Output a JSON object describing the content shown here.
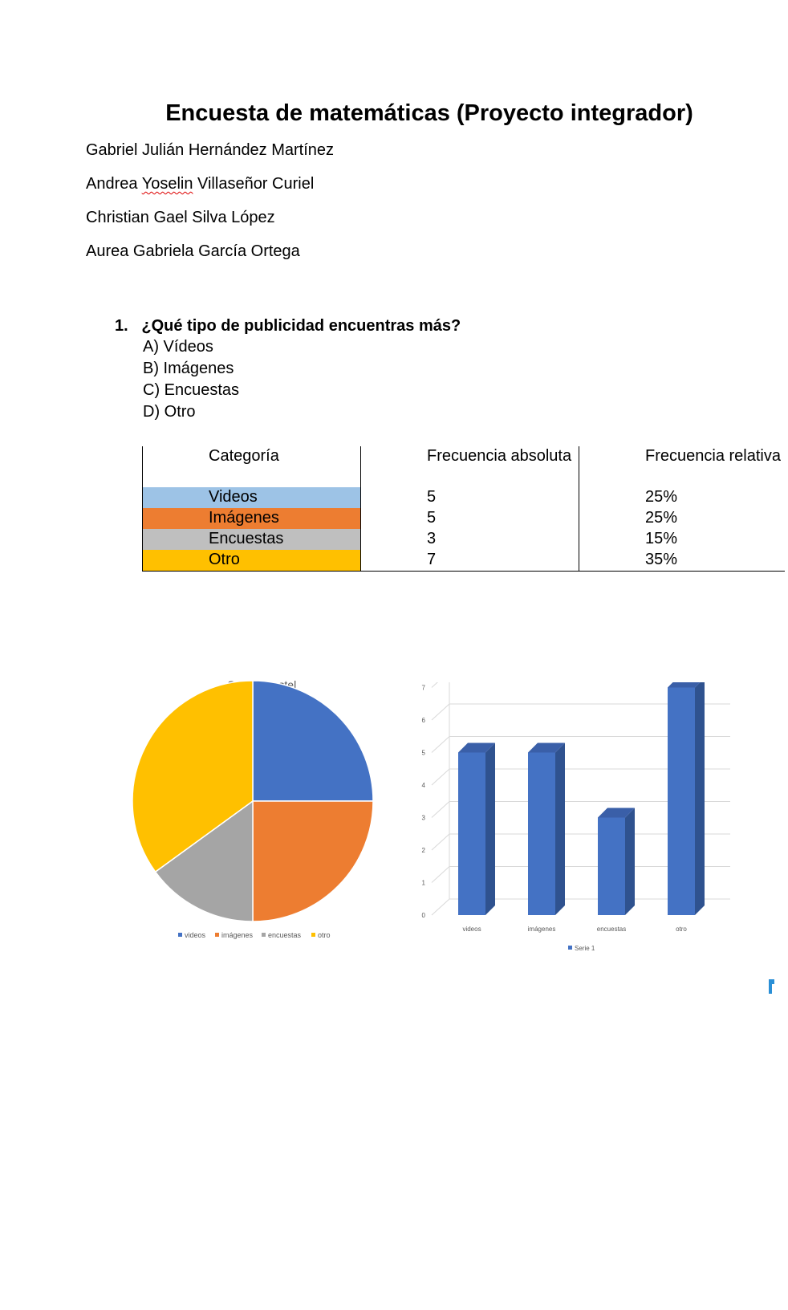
{
  "document": {
    "title": "Encuesta de matemáticas (Proyecto integrador)",
    "authors": [
      "Gabriel Julián Hernández Martínez",
      "Andrea ",
      "Yoselin",
      " Villaseñor Curiel",
      "Christian Gael Silva López",
      "Aurea Gabriela García Ortega"
    ]
  },
  "question": {
    "number": "1.",
    "text": "¿Qué tipo de publicidad encuentras más?",
    "options": [
      "A) Vídeos",
      "B) Imágenes",
      "C) Encuestas",
      "D) Otro"
    ]
  },
  "table": {
    "headers": [
      "Categoría",
      "Frecuencia absoluta",
      "Frecuencia relativa"
    ],
    "rows": [
      {
        "category": "Videos",
        "absolute": "5",
        "relative": "25%",
        "color": "#9dc3e6"
      },
      {
        "category": "Imágenes",
        "absolute": "5",
        "relative": "25%",
        "color": "#ed7d31"
      },
      {
        "category": "Encuestas",
        "absolute": "3",
        "relative": "15%",
        "color": "#bfbfbf"
      },
      {
        "category": "Otro",
        "absolute": "7",
        "relative": "35%",
        "color": "#ffc000"
      }
    ]
  },
  "chart_data": [
    {
      "type": "pie",
      "title": "Grafica pastel",
      "categories": [
        "videos",
        "imágenes",
        "encuestas",
        "otro"
      ],
      "values": [
        5,
        5,
        3,
        7
      ],
      "colors": [
        "#4472c4",
        "#ed7d31",
        "#a5a5a5",
        "#ffc000"
      ],
      "legend": "bottom"
    },
    {
      "type": "bar",
      "categories": [
        "videos",
        "imágenes",
        "encuestas",
        "otro"
      ],
      "series": [
        {
          "name": "Serie 1",
          "values": [
            5,
            5,
            3,
            7
          ]
        }
      ],
      "ylim": [
        0,
        7
      ],
      "yticks": [
        "0",
        "1",
        "2",
        "3",
        "4",
        "5",
        "6",
        "7"
      ],
      "grid": true,
      "legend": "bottom",
      "color": "#4472c4"
    }
  ]
}
